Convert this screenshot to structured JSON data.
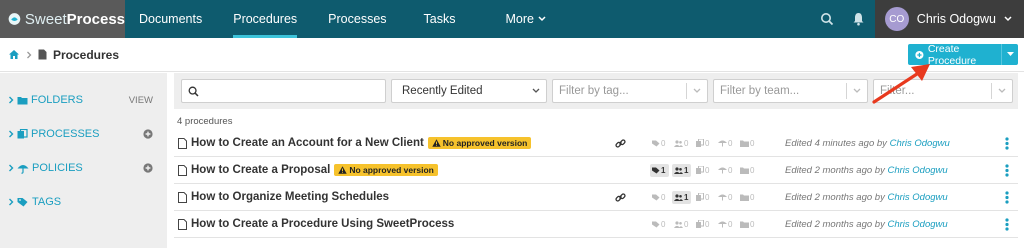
{
  "app": {
    "logo_sweet": "Sweet",
    "logo_process": "Process"
  },
  "nav": {
    "items": [
      {
        "label": "Documents"
      },
      {
        "label": "Procedures"
      },
      {
        "label": "Processes"
      },
      {
        "label": "Tasks"
      },
      {
        "label": "More"
      }
    ],
    "user_initials": "CO",
    "user_name": "Chris Odogwu"
  },
  "breadcrumb": {
    "current": "Procedures"
  },
  "create_button": {
    "label": "Create Procedure"
  },
  "sidebar": {
    "folders_label": "FOLDERS",
    "folders_action": "VIEW",
    "processes_label": "PROCESSES",
    "policies_label": "POLICIES",
    "tags_label": "TAGS"
  },
  "filters": {
    "sort_value": "Recently Edited",
    "tag_placeholder": "Filter by tag...",
    "team_placeholder": "Filter by team...",
    "extra_placeholder": "Filter..."
  },
  "list": {
    "count": "4 procedures",
    "rows": [
      {
        "title": "How to Create an Account for a New Client",
        "badge": "No approved version",
        "stats": [
          "0",
          "0",
          "0",
          "0",
          "0"
        ],
        "edited": "Edited 4 minutes ago by",
        "who": "Chris Odogwu"
      },
      {
        "title": "How to Create a Proposal",
        "badge": "No approved version",
        "stats": [
          "1",
          "1",
          "0",
          "0",
          "0"
        ],
        "edited": "Edited 2 months ago by",
        "who": "Chris Odogwu"
      },
      {
        "title": "How to Organize Meeting Schedules",
        "badge": "",
        "stats": [
          "0",
          "1",
          "0",
          "0",
          "0"
        ],
        "edited": "Edited 2 months ago by",
        "who": "Chris Odogwu"
      },
      {
        "title": "How to Create a Procedure Using SweetProcess",
        "badge": "",
        "stats": [
          "0",
          "0",
          "0",
          "0",
          "0"
        ],
        "edited": "Edited 2 months ago by",
        "who": "Chris Odogwu"
      }
    ]
  },
  "colors": {
    "nav_bg": "#0e5b6e",
    "accent": "#1fb1d0",
    "badge": "#f6c22c",
    "arrow": "#e8391e"
  }
}
